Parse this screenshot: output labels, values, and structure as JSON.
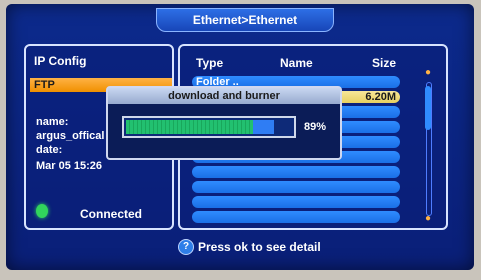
{
  "window": {
    "title": "Ethernet>Ethernet"
  },
  "left_panel": {
    "title": "IP Config",
    "selected_item": "FTP",
    "name_label": "name:",
    "name_value": "argus_offical",
    "date_label": "date:",
    "date_value": "Mar 05 15:26",
    "status": "Connected"
  },
  "file_list": {
    "columns": [
      "Type",
      "Name",
      "Size"
    ],
    "rows": [
      {
        "label": "Folder ..",
        "size": ""
      },
      {
        "label": "",
        "size": "6.20M",
        "highlighted": true
      },
      {
        "label": "",
        "size": ""
      },
      {
        "label": "",
        "size": ""
      },
      {
        "label": "",
        "size": ""
      },
      {
        "label": "",
        "size": ""
      },
      {
        "label": "",
        "size": ""
      },
      {
        "label": "",
        "size": ""
      },
      {
        "label": "",
        "size": ""
      },
      {
        "label": "",
        "size": ""
      }
    ]
  },
  "dialog": {
    "title": "download and burner",
    "progress": 0.89,
    "percent_label": "89%"
  },
  "footer": {
    "help_text": "Press ok to see detail",
    "help_icon": "help-icon"
  },
  "colors": {
    "accent": "#f09000",
    "progress": "#22c070",
    "highlight": "#e8d060"
  }
}
